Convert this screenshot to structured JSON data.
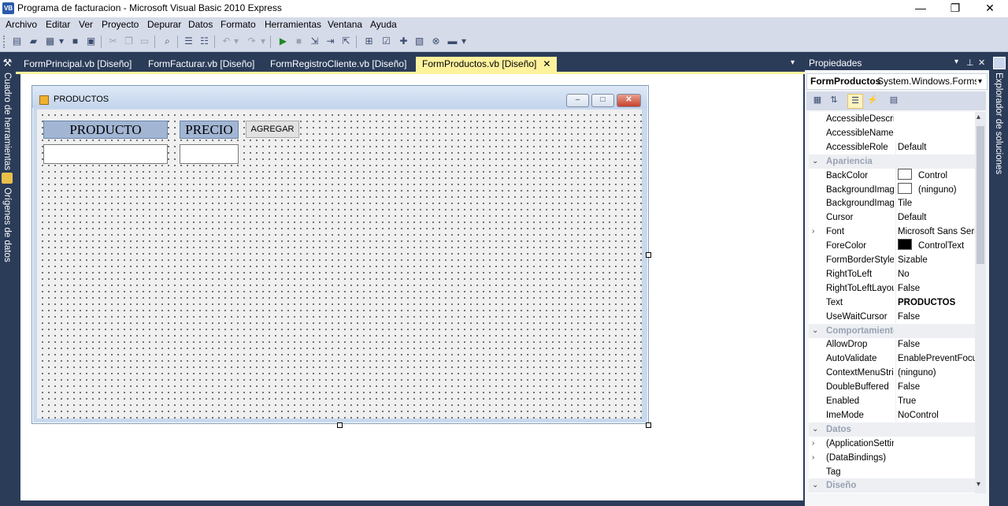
{
  "window": {
    "title": "Programa de facturacion - Microsoft Visual Basic 2010 Express",
    "app_icon": "VB",
    "controls": {
      "minimize": "—",
      "restore": "❐",
      "close": "✕"
    }
  },
  "menu": [
    "Archivo",
    "Editar",
    "Ver",
    "Proyecto",
    "Depurar",
    "Datos",
    "Formato",
    "Herramientas",
    "Ventana",
    "Ayuda"
  ],
  "toolbar": {
    "icons": [
      "new-project-icon",
      "open-icon",
      "add-item-icon",
      "save-icon",
      "save-all-icon",
      "cut-icon",
      "copy-icon",
      "paste-icon",
      "find-icon",
      "comment-icon",
      "uncomment-icon",
      "undo-icon",
      "redo-icon",
      "start-icon",
      "stop-icon",
      "step-into-icon",
      "step-over-icon",
      "step-out-icon",
      "solution-explorer-icon",
      "properties-icon",
      "toolbox-icon",
      "object-browser-icon",
      "error-list-icon",
      "output-icon"
    ],
    "overflow": "▾"
  },
  "left_dock": {
    "toolbox": "Cuadro de herramientas",
    "datasources": "Orígenes de datos"
  },
  "right_dock": {
    "solution_explorer": "Explorador de soluciones"
  },
  "tabs": [
    {
      "label": "FormPrincipal.vb [Diseño]"
    },
    {
      "label": "FormFacturar.vb [Diseño]"
    },
    {
      "label": "FormRegistroCliente.vb [Diseño]"
    },
    {
      "label": "FormProductos.vb [Diseño]"
    }
  ],
  "tab_close": "✕",
  "tab_dropdown": "▾",
  "form": {
    "title": "PRODUCTOS",
    "label_producto": "PRODUCTO",
    "label_precio": "PRECIO",
    "button_agregar": "AGREGAR",
    "input_producto_value": "",
    "input_precio_value": "",
    "min": "–",
    "max": "□",
    "close": "✕"
  },
  "properties": {
    "header": "Propiedades",
    "header_buttons": {
      "dropdown": "▾",
      "pin": "⊥",
      "close": "✕"
    },
    "object_name": "FormProductos",
    "object_type": "System.Windows.Forms.F",
    "object_dropdown": "▾",
    "rows": [
      {
        "expander": "",
        "name": "AccessibleDescrip",
        "value": ""
      },
      {
        "expander": "",
        "name": "AccessibleName",
        "value": ""
      },
      {
        "expander": "",
        "name": "AccessibleRole",
        "value": "Default"
      },
      {
        "expander": "⌄",
        "name": "Apariencia",
        "value": "",
        "category": true
      },
      {
        "expander": "",
        "name": "BackColor",
        "value": "Control",
        "swatch": "#ffffff"
      },
      {
        "expander": "",
        "name": "BackgroundImag",
        "value": "(ninguno)",
        "swatch": "#ffffff"
      },
      {
        "expander": "",
        "name": "BackgroundImag",
        "value": "Tile"
      },
      {
        "expander": "",
        "name": "Cursor",
        "value": "Default"
      },
      {
        "expander": "›",
        "name": "Font",
        "value": "Microsoft Sans Serif"
      },
      {
        "expander": "",
        "name": "ForeColor",
        "value": "ControlText",
        "swatch": "#000000"
      },
      {
        "expander": "",
        "name": "FormBorderStyle",
        "value": "Sizable"
      },
      {
        "expander": "",
        "name": "RightToLeft",
        "value": "No"
      },
      {
        "expander": "",
        "name": "RightToLeftLayou",
        "value": "False"
      },
      {
        "expander": "",
        "name": "Text",
        "value": "PRODUCTOS",
        "bold": true
      },
      {
        "expander": "",
        "name": "UseWaitCursor",
        "value": "False"
      },
      {
        "expander": "⌄",
        "name": "Comportamiento",
        "value": "",
        "category": true
      },
      {
        "expander": "",
        "name": "AllowDrop",
        "value": "False"
      },
      {
        "expander": "",
        "name": "AutoValidate",
        "value": "EnablePreventFocus"
      },
      {
        "expander": "",
        "name": "ContextMenuStri",
        "value": "(ninguno)"
      },
      {
        "expander": "",
        "name": "DoubleBuffered",
        "value": "False"
      },
      {
        "expander": "",
        "name": "Enabled",
        "value": "True"
      },
      {
        "expander": "",
        "name": "ImeMode",
        "value": "NoControl"
      },
      {
        "expander": "⌄",
        "name": "Datos",
        "value": "",
        "category": true
      },
      {
        "expander": "›",
        "name": "(ApplicationSettin",
        "value": ""
      },
      {
        "expander": "›",
        "name": "(DataBindings)",
        "value": ""
      },
      {
        "expander": "",
        "name": "Tag",
        "value": ""
      },
      {
        "expander": "⌄",
        "name": "Diseño",
        "value": "",
        "category": true
      }
    ],
    "tool_icons": [
      "categorized-icon",
      "alphabetical-icon",
      "properties-icon",
      "events-icon",
      "property-pages-icon"
    ],
    "scroll_up": "▴",
    "scroll_down": "▾"
  }
}
